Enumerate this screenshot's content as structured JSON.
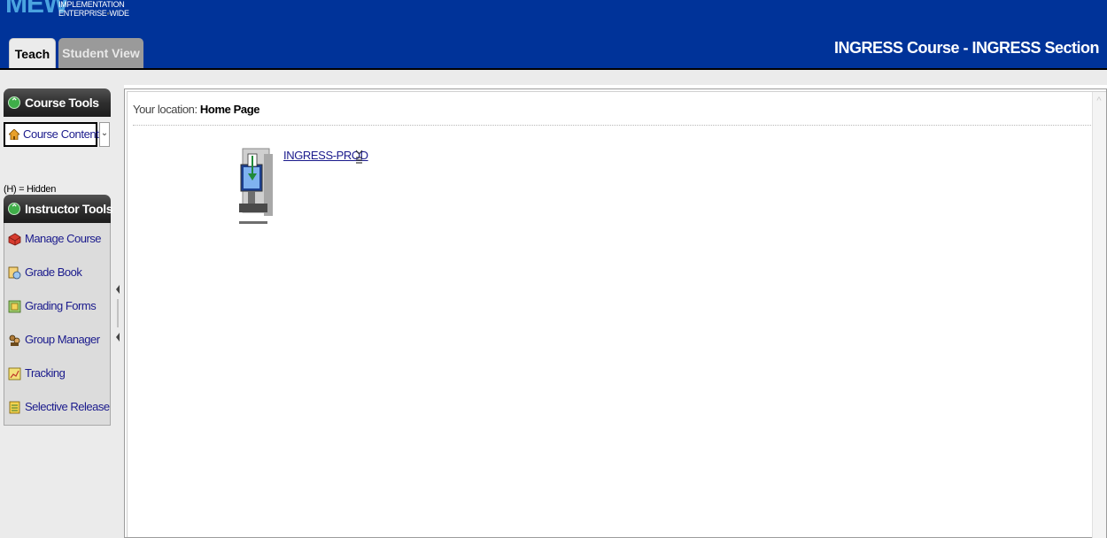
{
  "header": {
    "logo": {
      "letters": "MEW",
      "line1": "IMPLEMENTATION",
      "line2a": "ENTERPRISE",
      "line2b": "WIDE"
    },
    "tabs": [
      {
        "label": "Teach",
        "active": true
      },
      {
        "label": "Student View",
        "active": false
      }
    ],
    "title": "INGRESS Course - INGRESS Section",
    "background_color": "#003399"
  },
  "sidebar": {
    "course_tools": {
      "heading": "Course Tools",
      "selected": "Course Content",
      "hidden_note": "(H) = Hidden"
    },
    "instructor_tools": {
      "heading": "Instructor Tools",
      "items": [
        {
          "label": "Manage Course",
          "icon": "manage-course-icon"
        },
        {
          "label": "Grade Book",
          "icon": "grade-book-icon"
        },
        {
          "label": "Grading Forms",
          "icon": "grading-forms-icon"
        },
        {
          "label": "Group Manager",
          "icon": "group-manager-icon"
        },
        {
          "label": "Tracking",
          "icon": "tracking-icon"
        },
        {
          "label": "Selective Release",
          "icon": "selective-release-icon"
        }
      ]
    }
  },
  "main": {
    "location_prefix": "Your location:",
    "location": "Home Page",
    "items": [
      {
        "label": "INGRESS-PROD",
        "icon": "computer-download-icon"
      }
    ]
  }
}
